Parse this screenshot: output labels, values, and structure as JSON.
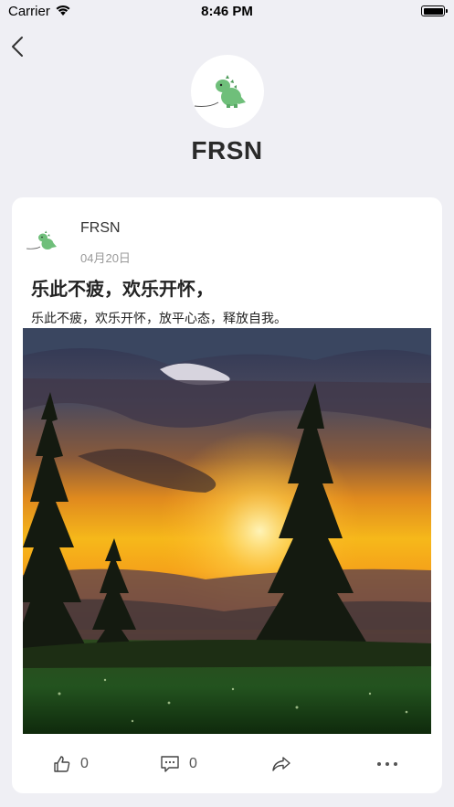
{
  "status_bar": {
    "carrier": "Carrier",
    "time": "8:46 PM"
  },
  "profile": {
    "name": "FRSN"
  },
  "post": {
    "author": "FRSN",
    "date": "04月20日",
    "title": "乐此不疲，欢乐开怀，",
    "body": "乐此不疲，欢乐开怀，放平心态，释放自我。",
    "likes": "0",
    "comments": "0"
  },
  "icons": {
    "back": "chevron-left-icon",
    "like": "thumbs-up-icon",
    "comment": "comment-icon",
    "share": "share-icon",
    "more": "more-icon"
  }
}
